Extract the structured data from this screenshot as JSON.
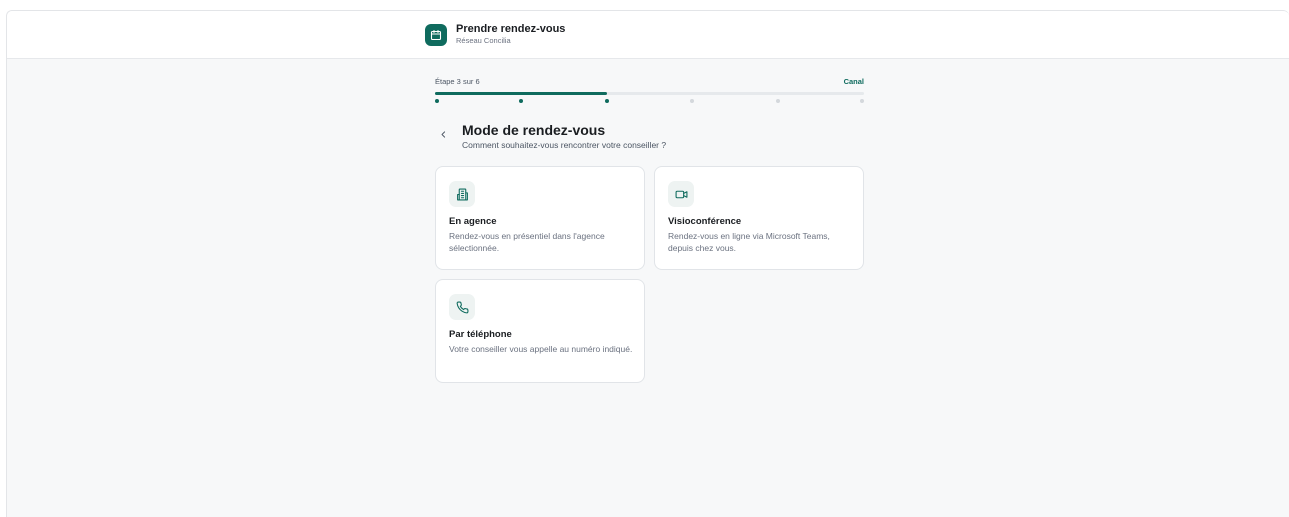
{
  "header": {
    "title": "Prendre rendez-vous",
    "subtitle": "Réseau Concilia",
    "badge_icon": "calendar-icon",
    "accent_color": "#0f6b5e"
  },
  "stepper": {
    "label": "Étape 3 sur 6",
    "step_name": "Canal",
    "current_step": 3,
    "total_steps": 6,
    "progress": 0.4
  },
  "page": {
    "title": "Mode de rendez-vous",
    "subtitle": "Comment souhaitez-vous rencontrer votre conseiller ?",
    "back_icon": "chevron-left-icon"
  },
  "options": [
    {
      "icon": "building-icon",
      "title": "En agence",
      "description": "Rendez-vous en présentiel dans l'agence sélectionnée."
    },
    {
      "icon": "video-camera-icon",
      "title": "Visioconférence",
      "description": "Rendez-vous en ligne via Microsoft Teams, depuis chez vous."
    },
    {
      "icon": "phone-icon",
      "title": "Par téléphone",
      "description": "Votre conseiller vous appelle au numéro indiqué."
    }
  ]
}
